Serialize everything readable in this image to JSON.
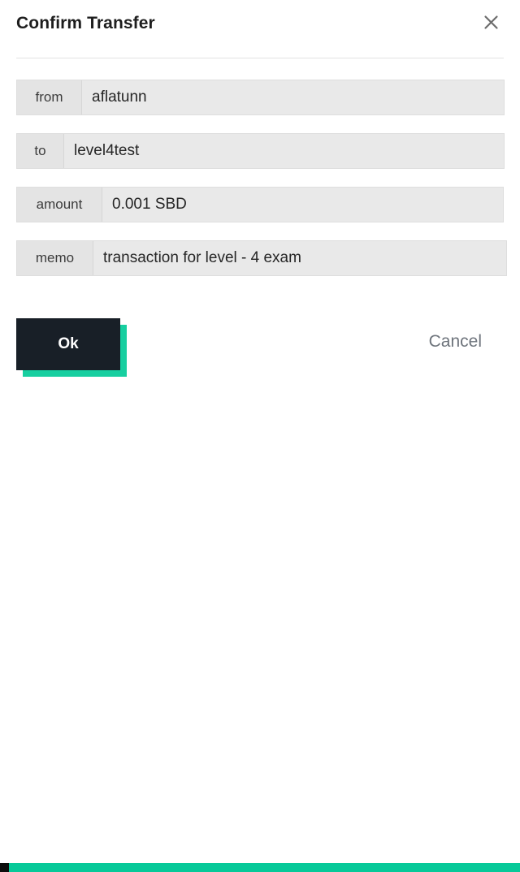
{
  "dialog": {
    "title": "Confirm Transfer",
    "close_icon": "close-icon",
    "fields": [
      {
        "label": "from",
        "value": "aflatunn"
      },
      {
        "label": "to",
        "value": "level4test"
      },
      {
        "label": "amount",
        "value": "0.001 SBD"
      },
      {
        "label": "memo",
        "value": "transaction for level - 4 exam"
      }
    ],
    "actions": {
      "ok_label": "Ok",
      "cancel_label": "Cancel"
    }
  },
  "colors": {
    "accent": "#17cfa0",
    "bottom_bar": "#07c999",
    "button_dark": "#181f27",
    "field_bg": "#e9e9e9",
    "label_bg": "#e4e4e4"
  }
}
